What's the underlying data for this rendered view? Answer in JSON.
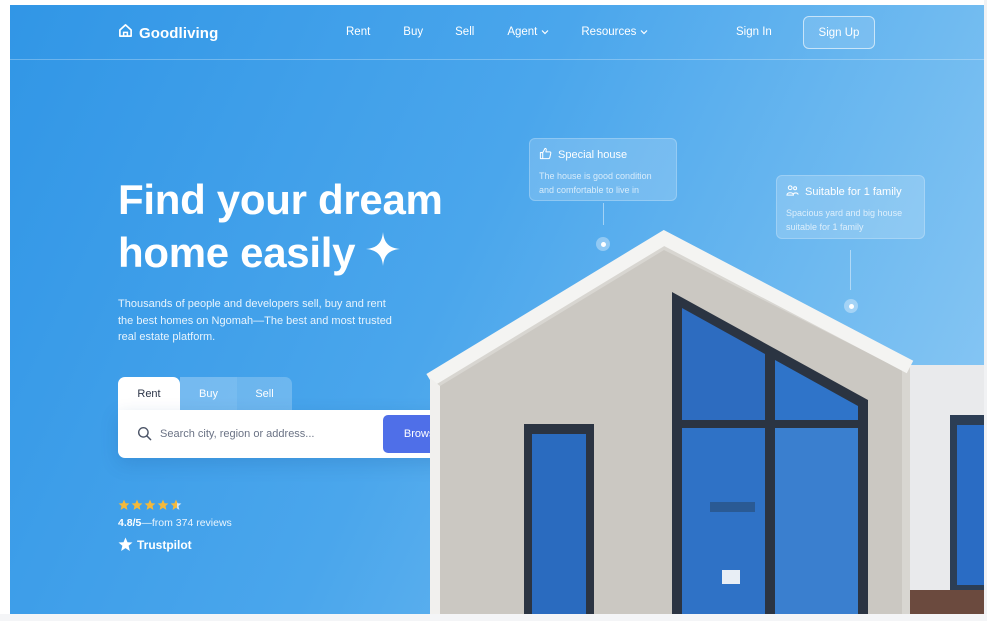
{
  "brand": {
    "name": "Goodliving",
    "icon": "house-outline-icon"
  },
  "nav": {
    "links": [
      {
        "label": "Rent"
      },
      {
        "label": "Buy"
      },
      {
        "label": "Sell"
      },
      {
        "label": "Agent",
        "icon": "chevron-down-icon"
      },
      {
        "label": "Resources",
        "icon": "chevron-down-icon"
      }
    ],
    "sign_in": "Sign In",
    "sign_up": "Sign Up"
  },
  "hero": {
    "title_line1": "Find your dream",
    "title_line2": "home easily",
    "description": "Thousands of people and developers sell, buy and rent the best homes on Ngomah—The best and most trusted real estate platform."
  },
  "search": {
    "tabs": [
      {
        "label": "Rent",
        "active": true
      },
      {
        "label": "Buy",
        "active": false
      },
      {
        "label": "Sell",
        "active": false
      }
    ],
    "placeholder": "Search city, region or address...",
    "button": "Browse House's"
  },
  "rating": {
    "stars": 4.8,
    "score": "4.8/5",
    "reviews_text": "—from 374 reviews",
    "provider": "Trustpilot"
  },
  "cards": [
    {
      "title": "Special house",
      "icon": "thumbs-up-icon",
      "body": "The house is good condition and comfortable to live in"
    },
    {
      "title": "Suitable for 1 family",
      "icon": "family-icon",
      "body": "Spacious yard and big house suitable for 1 family"
    }
  ],
  "colors": {
    "accent": "#4f6fe8",
    "hero_bg": "#3196e6",
    "star": "#f5b93a"
  }
}
